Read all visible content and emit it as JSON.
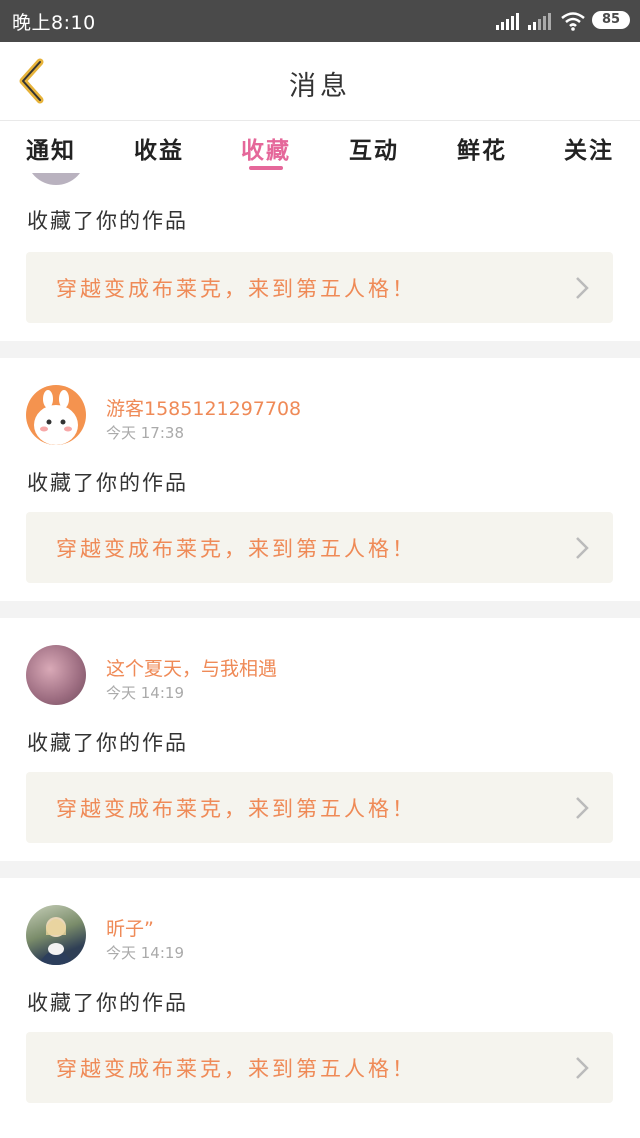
{
  "status": {
    "time": "晚上8:10",
    "battery": "85"
  },
  "header": {
    "title": "消息"
  },
  "tabs": [
    {
      "label": "通知"
    },
    {
      "label": "收益"
    },
    {
      "label": "收藏"
    },
    {
      "label": "互动"
    },
    {
      "label": "鲜花"
    },
    {
      "label": "关注"
    }
  ],
  "active_tab": "收藏",
  "items": [
    {
      "user": "",
      "time": "",
      "action": "收藏了你的作品",
      "work_title": "穿越变成布莱克，来到第五人格！"
    },
    {
      "user": "游客1585121297708",
      "time": "今天 17:38",
      "action": "收藏了你的作品",
      "work_title": "穿越变成布莱克，来到第五人格！"
    },
    {
      "user": "这个夏天，与我相遇",
      "time": "今天 14:19",
      "action": "收藏了你的作品",
      "work_title": "穿越变成布莱克，来到第五人格！"
    },
    {
      "user": "昕子”",
      "time": "今天 14:19",
      "action": "收藏了你的作品",
      "work_title": "穿越变成布莱克，来到第五人格！"
    }
  ],
  "colors": {
    "accent": "#e5679a",
    "name": "#ef8a57",
    "statusbar": "#4a4a4a"
  }
}
